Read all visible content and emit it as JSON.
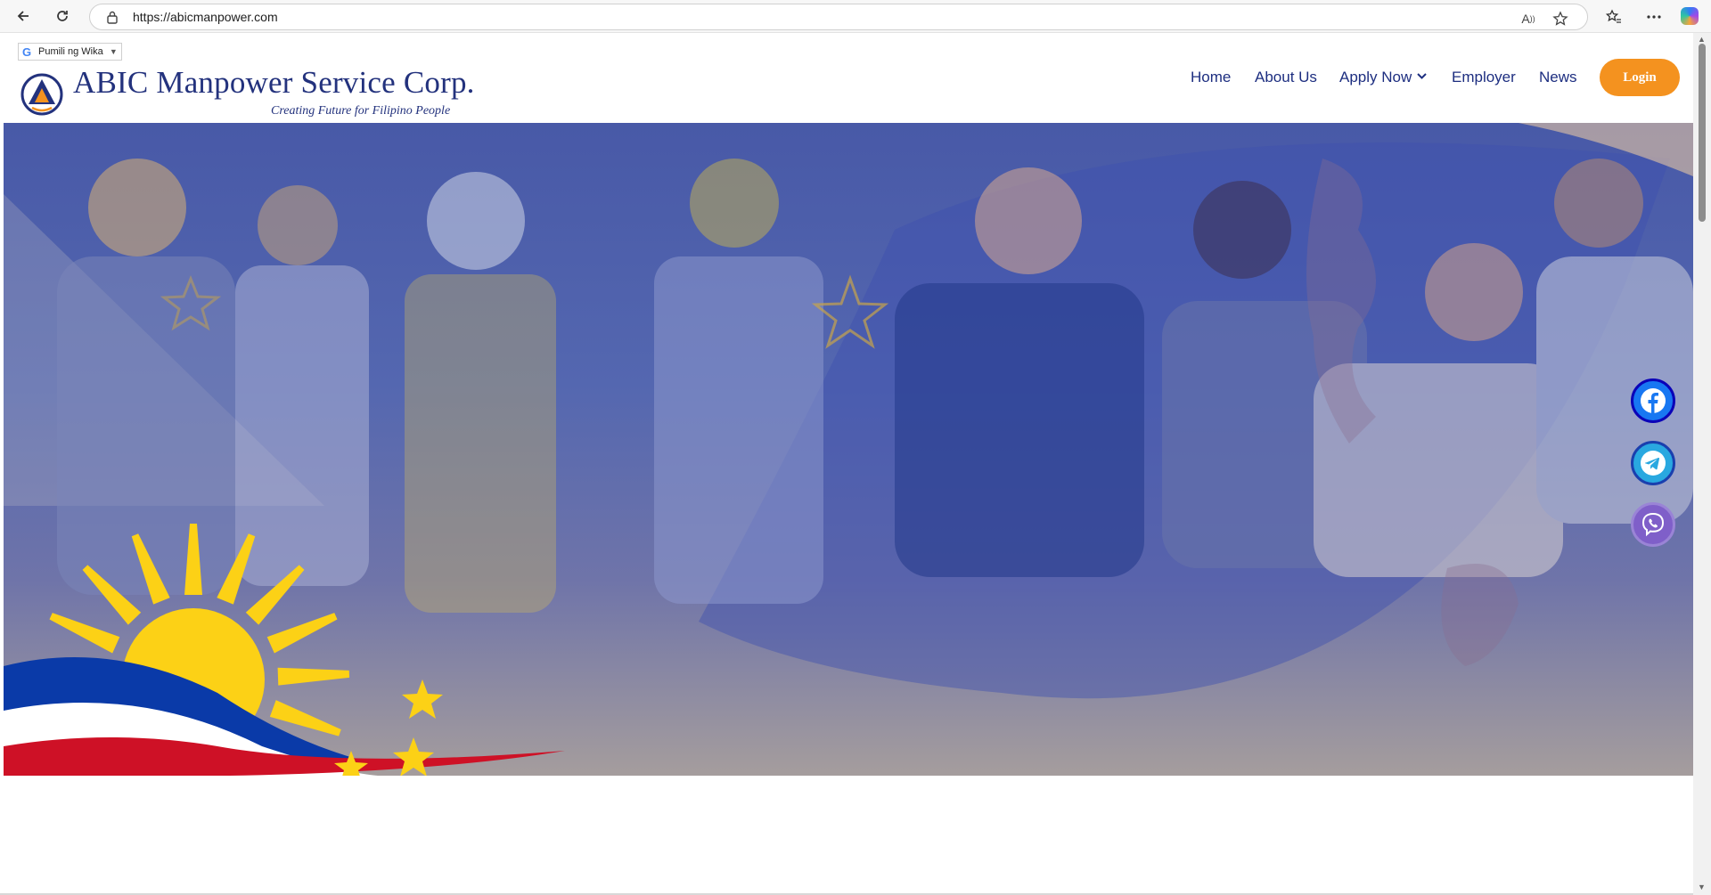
{
  "browser": {
    "url": "https://abicmanpower.com"
  },
  "translate": {
    "label": "Pumili ng Wika",
    "logo_letter": "G",
    "arrow": "▼"
  },
  "header": {
    "brand": "ABIC Manpower Service Corp.",
    "tagline": "Creating Future for Filipino People"
  },
  "nav": {
    "home": "Home",
    "about": "About Us",
    "apply": "Apply Now",
    "employer": "Employer",
    "news": "News",
    "login": "Login"
  },
  "social": {
    "icons": [
      "facebook-icon",
      "telegram-icon",
      "viber-icon"
    ]
  },
  "colors": {
    "brand_blue": "#23327d",
    "nav_blue": "#1d2e80",
    "login_orange": "#f4921f",
    "flag_blue": "#0a3aa8",
    "flag_red": "#ce1126",
    "sun_yellow": "#fcd116"
  }
}
